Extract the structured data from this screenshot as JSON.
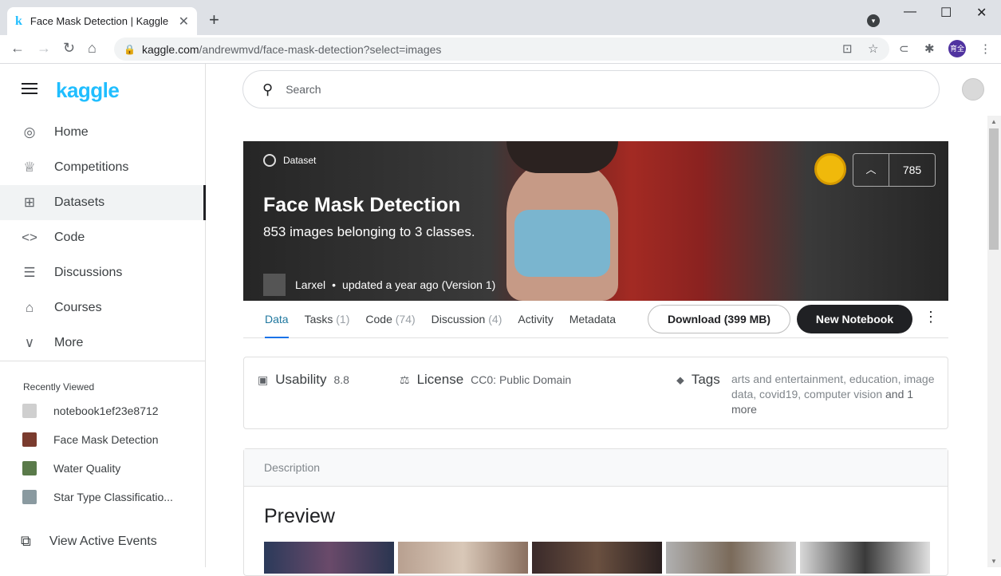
{
  "browser": {
    "tab_title": "Face Mask Detection | Kaggle",
    "tab_favicon": "k",
    "url_domain": "kaggle.com",
    "url_path": "/andrewmvd/face-mask-detection?select=images",
    "profile_initials": "育全"
  },
  "sidebar": {
    "logo": "kaggle",
    "items": [
      {
        "label": "Home",
        "icon": "compass-icon",
        "glyph": "◎"
      },
      {
        "label": "Competitions",
        "icon": "trophy-icon",
        "glyph": "🏆"
      },
      {
        "label": "Datasets",
        "icon": "table-icon",
        "glyph": "⊞"
      },
      {
        "label": "Code",
        "icon": "code-icon",
        "glyph": "<>"
      },
      {
        "label": "Discussions",
        "icon": "comment-icon",
        "glyph": "☰"
      },
      {
        "label": "Courses",
        "icon": "school-icon",
        "glyph": "🎓"
      },
      {
        "label": "More",
        "icon": "chevron-down-icon",
        "glyph": "∨"
      }
    ],
    "recently_viewed_title": "Recently Viewed",
    "recent": [
      {
        "label": "notebook1ef23e8712",
        "color": "#cfcfcf"
      },
      {
        "label": "Face Mask Detection",
        "color": "#7a3b2e"
      },
      {
        "label": "Water Quality",
        "color": "#5a7a4a"
      },
      {
        "label": "Star Type Classificatio...",
        "color": "#8a9aa0"
      }
    ],
    "events_label": "View Active Events"
  },
  "search": {
    "placeholder": "Search"
  },
  "dataset": {
    "tag": "Dataset",
    "title": "Face Mask Detection",
    "subtitle": "853 images belonging to 3 classes.",
    "author": "Larxel",
    "updated": "updated a year ago (Version 1)",
    "votes": "785"
  },
  "subnav": {
    "tabs": [
      {
        "label": "Data",
        "count": ""
      },
      {
        "label": "Tasks",
        "count": "(1)"
      },
      {
        "label": "Code",
        "count": "(74)"
      },
      {
        "label": "Discussion",
        "count": "(4)"
      },
      {
        "label": "Activity",
        "count": ""
      },
      {
        "label": "Metadata",
        "count": ""
      }
    ],
    "download": "Download (399 MB)",
    "new_notebook": "New Notebook"
  },
  "info": {
    "usability_label": "Usability",
    "usability_value": "8.8",
    "license_label": "License",
    "license_value": "CC0: Public Domain",
    "tags_label": "Tags",
    "tags_value": "arts and entertainment, education, image data, covid19, computer vision",
    "tags_more": "and 1 more"
  },
  "description": {
    "header": "Description",
    "preview_heading": "Preview"
  },
  "colors": {
    "brand": "#20beff",
    "dark_button": "#202124",
    "active_tab": "#20789f"
  }
}
